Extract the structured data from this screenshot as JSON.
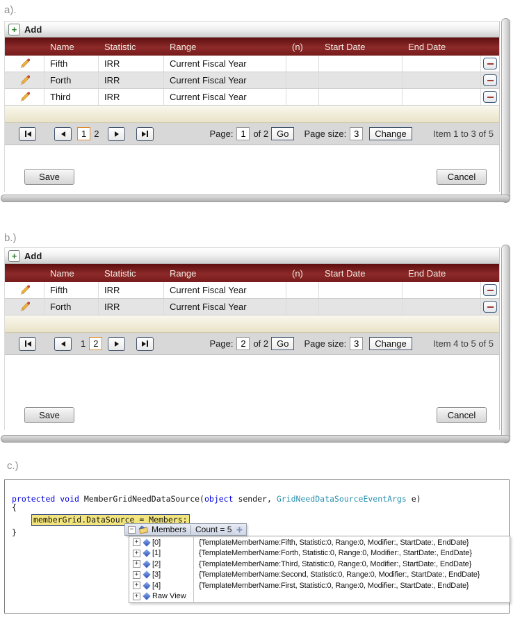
{
  "colors": {
    "grid_header_maroon": "#7a1a1a",
    "current_page_border": "#e08a2e",
    "row_alt": "#e4e4e4",
    "filler_beige": "#efead2",
    "code_keyword_blue": "#0000e0",
    "code_type_teal": "#2b91af",
    "debug_highlight_bg": "#f3e57e",
    "debug_highlight_border": "#3c4e85"
  },
  "icons": {
    "add": "+",
    "delete": "minus",
    "edit": "pencil",
    "first_page": "bar-left-triangle",
    "prev_page": "left-triangle",
    "next_page": "right-triangle",
    "last_page": "right-triangle-bar",
    "expand": "+",
    "collapse": "−",
    "field": "blue-diamond"
  },
  "sections": {
    "a": {
      "label": "a).",
      "toolbar": {
        "add_label": "Add"
      },
      "grid": {
        "columns": [
          "",
          "Name",
          "Statistic",
          "Range",
          "(n)",
          "Start Date",
          "End Date",
          ""
        ],
        "rows": [
          {
            "name": "Fifth",
            "statistic": "IRR",
            "range": "Current Fiscal Year",
            "n": "",
            "start_date": "",
            "end_date": ""
          },
          {
            "name": "Forth",
            "statistic": "IRR",
            "range": "Current Fiscal Year",
            "n": "",
            "start_date": "",
            "end_date": ""
          },
          {
            "name": "Third",
            "statistic": "IRR",
            "range": "Current Fiscal Year",
            "n": "",
            "start_date": "",
            "end_date": ""
          }
        ]
      },
      "pager": {
        "pages": [
          "1",
          "2"
        ],
        "current": "1",
        "page_label": "Page:",
        "page_value": "1",
        "of_label": "of 2",
        "go_label": "Go",
        "size_label": "Page size:",
        "size_value": "3",
        "change_label": "Change",
        "item_status": "Item 1 to 3 of 5"
      },
      "save_label": "Save",
      "cancel_label": "Cancel"
    },
    "b": {
      "label": "b.)",
      "toolbar": {
        "add_label": "Add"
      },
      "grid": {
        "columns": [
          "",
          "Name",
          "Statistic",
          "Range",
          "(n)",
          "Start Date",
          "End Date",
          ""
        ],
        "rows": [
          {
            "name": "Fifth",
            "statistic": "IRR",
            "range": "Current Fiscal Year",
            "n": "",
            "start_date": "",
            "end_date": ""
          },
          {
            "name": "Forth",
            "statistic": "IRR",
            "range": "Current Fiscal Year",
            "n": "",
            "start_date": "",
            "end_date": ""
          }
        ]
      },
      "pager": {
        "pages": [
          "1",
          "2"
        ],
        "current": "2",
        "page_label": "Page:",
        "page_value": "2",
        "of_label": "of 2",
        "go_label": "Go",
        "size_label": "Page size:",
        "size_value": "3",
        "change_label": "Change",
        "item_status": "Item 4 to 5 of 5"
      },
      "save_label": "Save",
      "cancel_label": "Cancel"
    },
    "c": {
      "label": "c.)",
      "code": {
        "tokens": [
          {
            "text": "protected",
            "cls": "kw"
          },
          {
            "text": " ",
            "cls": "pl"
          },
          {
            "text": "void",
            "cls": "kw"
          },
          {
            "text": " MemberGridNeedDataSource(",
            "cls": "pl"
          },
          {
            "text": "object",
            "cls": "kw"
          },
          {
            "text": " sender, ",
            "cls": "pl"
          },
          {
            "text": "GridNeedDataSourceEventArgs",
            "cls": "ty"
          },
          {
            "text": " e)",
            "cls": "pl"
          }
        ],
        "open_brace": "{",
        "highlight": "memberGrid.DataSource = Members;",
        "close_brace": "}"
      },
      "datatip": {
        "root_name": "Members",
        "count": "Count = 5",
        "rows": [
          {
            "name": "[0]",
            "value": "{TemplateMemberName:Fifth, Statistic:0, Range:0, Modifier:, StartDate:, EndDate}"
          },
          {
            "name": "[1]",
            "value": "{TemplateMemberName:Forth, Statistic:0, Range:0, Modifier:, StartDate:, EndDate}"
          },
          {
            "name": "[2]",
            "value": "{TemplateMemberName:Third, Statistic:0, Range:0, Modifier:, StartDate:, EndDate}"
          },
          {
            "name": "[3]",
            "value": "{TemplateMemberName:Second, Statistic:0, Range:0, Modifier:, StartDate:, EndDate}"
          },
          {
            "name": "[4]",
            "value": "{TemplateMemberName:First, Statistic:0, Range:0, Modifier:, StartDate:, EndDate}"
          },
          {
            "name": "Raw View",
            "value": ""
          }
        ]
      }
    }
  }
}
